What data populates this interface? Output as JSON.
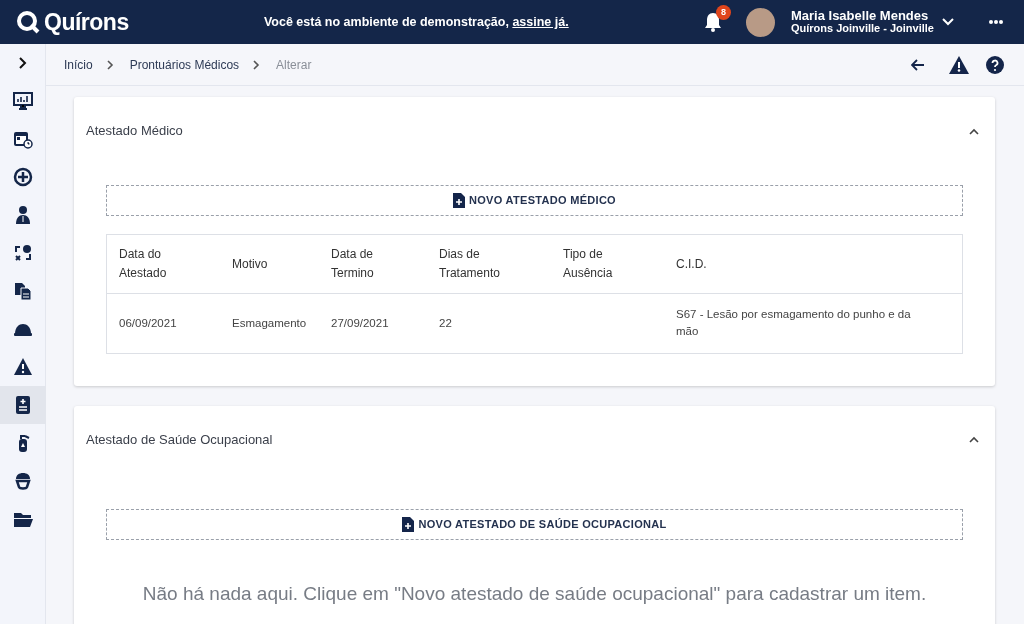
{
  "header": {
    "logo": "Quírons",
    "banner_text": "Você está no ambiente de demonstração,",
    "banner_link": "assine já.",
    "notifications": "8",
    "user_name": "Maria Isabelle Mendes",
    "user_company": "Quírons Joinville - Joinville"
  },
  "sidebar": {
    "items": [
      {
        "selected": false
      },
      {
        "selected": false
      },
      {
        "selected": false
      },
      {
        "selected": false
      },
      {
        "selected": false
      },
      {
        "selected": false
      },
      {
        "selected": false
      },
      {
        "selected": false
      },
      {
        "selected": true
      },
      {
        "selected": false
      },
      {
        "selected": false
      },
      {
        "selected": false
      }
    ]
  },
  "breadcrumb": [
    "Início",
    "Prontuários Médicos",
    "Alterar"
  ],
  "sections": [
    {
      "title": "Atestado Médico",
      "expanded": true,
      "button": "NOVO ATESTADO MÉDICO",
      "table": {
        "columns": [
          "Data do Atestado",
          "Motivo",
          "Data de Termino",
          "Dias de Tratamento",
          "Tipo de Ausência",
          "C.I.D."
        ],
        "rows": [
          [
            "06/09/2021",
            "Esmagamento",
            "27/09/2021",
            "22",
            "",
            "S67 - Lesão por esmagamento do punho e da mão"
          ]
        ]
      }
    },
    {
      "title": "Atestado de Saúde Ocupacional",
      "expanded": true,
      "button": "NOVO ATESTADO DE SAÚDE OCUPACIONAL",
      "empty_text": "Não há nada aqui. Clique em \"Novo atestado de saúde ocupacional\" para cadastrar um item."
    }
  ]
}
